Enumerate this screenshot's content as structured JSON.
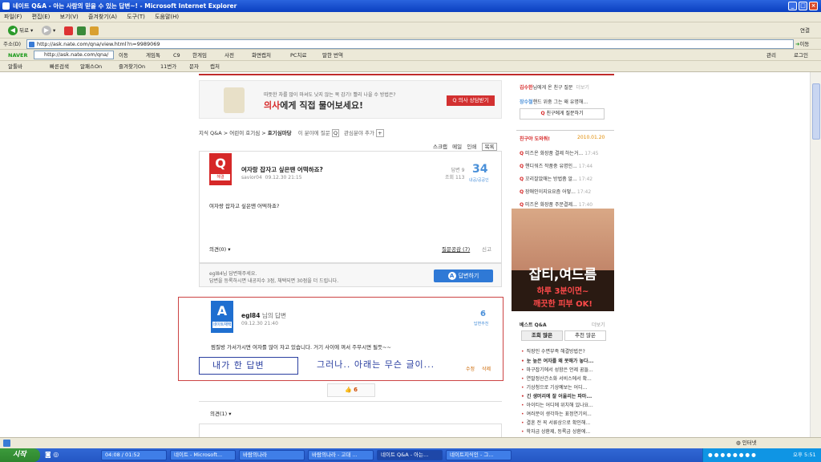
{
  "window": {
    "title": "네이트 Q&A - 아는 사람의 믿을 수 있는 답변~! - Microsoft Internet Explorer"
  },
  "menu": [
    "파일(F)",
    "편집(E)",
    "보기(V)",
    "즐겨찾기(A)",
    "도구(T)",
    "도움말(H)"
  ],
  "toolbar": {
    "back": "뒤로",
    "links": "연결"
  },
  "address": {
    "label": "주소(D)",
    "url": "http://ask.nate.com/qna/view.html?n=9989069",
    "go": "이동"
  },
  "navbar": {
    "brand": "NAVER",
    "search": "http://ask.nate.com/qna/",
    "items": [
      "이동",
      "게임톡",
      "C9",
      "한게임",
      "사전",
      "화면캡처",
      "PC치료",
      "말한 번역"
    ],
    "right": [
      "관리",
      "로그인"
    ]
  },
  "favbar": {
    "items": [
      "알툴바",
      "빠른검색",
      "알패스On",
      "즐겨찾기On",
      "11번가",
      "문자",
      "캡처"
    ]
  },
  "ad_top": {
    "line1": "따뜻한 차를 많이 마셔도 낫지 않는 목 감기! 빨리 나을 수 방법은?",
    "line2a": "의사",
    "line2b": "에게 직접 물어보세요!",
    "btn": "의사 상담받기"
  },
  "breadcrumb": {
    "path": "지식 Q&A > 어린이 호기심 > ",
    "current": "호기심마당",
    "extra1": "이 분야에 질문",
    "extra2": "관심분야 추가"
  },
  "tools": [
    "스크랩",
    "메일",
    "인쇄",
    "목록"
  ],
  "question": {
    "badge": "Q",
    "badge_label": "해결",
    "title": "여자랑 잡자고 싶은땐 어떡하죠?",
    "user": "savior04",
    "date": "09.12.30 21:15",
    "answers_label": "답변",
    "answers": "9",
    "views_label": "조회",
    "views": "113",
    "score": "34",
    "score_label": "내공/공공인",
    "body": "여자랑 잡자고 싶은땐 어떡하죠?",
    "comments": "의견(0)",
    "empathy": "질문공감 (7)",
    "report": "신고",
    "hint1": "egl84님 답변해주세요.",
    "hint2": "답변을 등록하시면 내공지수 3점, 채택되면 30점을 더 드립니다.",
    "answer_btn": "답변하기"
  },
  "answer": {
    "badge": "A",
    "badge_label": "네이트채택",
    "user": "egl84",
    "user_suffix": "님의 답변",
    "date": "09.12.30 21:40",
    "score": "6",
    "score_label": "답변추천",
    "body": "찜질방 가서가시면 여자를 많이 자고 있습니다. 거기 사이에 껴서 주무시면 될듯~~",
    "edit": "수정",
    "delete": "삭제",
    "note_mine": "내가 한 답변",
    "note_below": "그러나.. 아래는 무슨 글이...",
    "like": "6",
    "comments": "의견(1)"
  },
  "sidebar": {
    "notice_user": "김수한",
    "notice_text": "님에게 온 친구 질문",
    "more": "더보기",
    "notice2_user": "장수철",
    "notice2_text": "핸드 위중 그는 왜 유명해...",
    "friend_btn": "친구에게 질문하기",
    "help_title": "친구야 도와줘!",
    "help_date": "2010.01.20",
    "help_items": [
      {
        "text": "미즈온 화장품 결제 하는거...",
        "time": "17:45"
      },
      {
        "text": "핸디워즈 작품중 유명인...",
        "time": "17:44"
      },
      {
        "text": "꼬리잘았애는 방법좀 알...",
        "time": "17:42"
      },
      {
        "text": "장애인이지요요즘 어떻...",
        "time": "17:42"
      },
      {
        "text": "미즈온 화장품 주문결제...",
        "time": "17:40"
      }
    ],
    "ad_big": "잡티,여드름",
    "ad_sub1": "하루 3분이면~",
    "ad_sub2": "깨끗한 피부 OK!",
    "best_title": "베스트 Q&A",
    "tabs": [
      "조회 많은",
      "추천 많은"
    ],
    "best_items": [
      "직장인 수면부족 해결방법은?",
      "눈 높은 여자를 왜 못해가 놓다...",
      "마구잡기에서 성함은 언제 꿈들...",
      "연말정산간소화 서비스에서 확...",
      "기상청으로 기상예보는 어디...",
      "긴 생머리에 잘 어울리는 파마...",
      "아이티는 어디에 위치해 있나요...",
      "여러분이 생각하는 표정연기의...",
      "결혼 전 꼭 서류상으로 확인해...",
      "학자금 상환제, 등록금 상환에..."
    ]
  },
  "status": {
    "zone": "인터넷"
  },
  "taskbar": {
    "start": "시작",
    "tasks": [
      "04:08 / 01:52",
      "네이트 - Microsoft...",
      "바람의나라",
      "바람의나라 - 고대 ...",
      "네이트 Q&A - 아는...",
      "네이트지식인 - 그..."
    ],
    "clock": "오후 5:51"
  }
}
